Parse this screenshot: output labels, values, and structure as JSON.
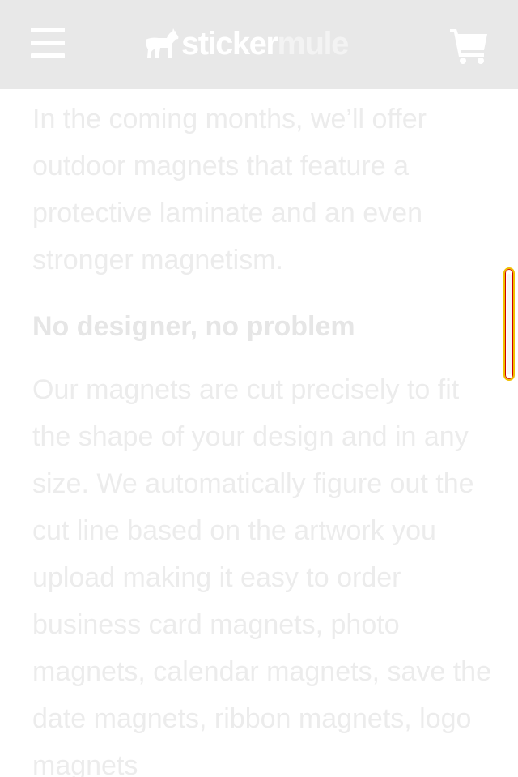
{
  "header": {
    "brand": {
      "part1": "sticker",
      "part2": "mule"
    },
    "menu_icon": "hamburger-menu-icon",
    "logo_icon": "mule-logo-icon",
    "cart_icon": "shopping-cart-icon"
  },
  "content": {
    "intro_paragraph": "In the coming months, we’ll offer outdoor magnets that feature a protective laminate and an even stronger magnetism.",
    "section_heading": "No designer, no problem",
    "section_paragraph": "Our magnets are cut precisely to fit the shape of your design and in any size. We automatically figure out the cut line based on the artwork you upload making it easy to order business card magnets, photo magnets, calendar magnets, save the date magnets, ribbon magnets, logo magnets"
  },
  "colors": {
    "header_bg": "#e8e8e8",
    "text_faded": "#ececec",
    "scrollbar_border": "#f0c000",
    "scrollbar_accent": "#d10000"
  }
}
